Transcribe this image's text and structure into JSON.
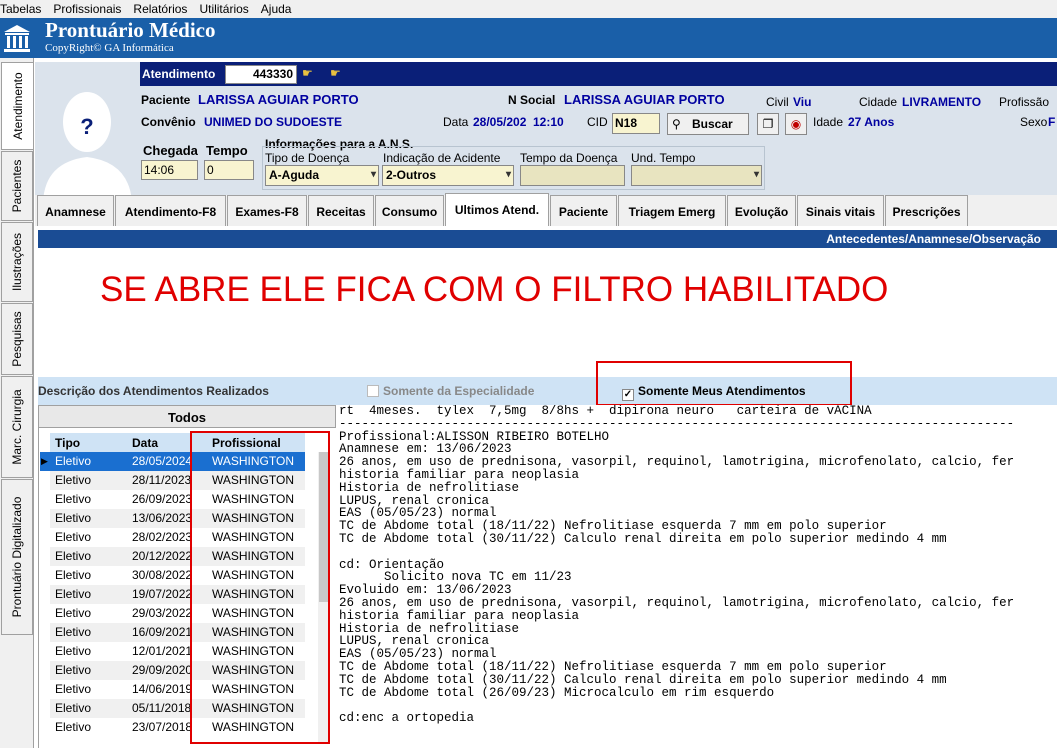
{
  "menu": [
    "Tabelas",
    "Profissionais",
    "Relatórios",
    "Utilitários",
    "Ajuda"
  ],
  "app": {
    "title": "Prontuário Médico",
    "copyright": "CopyRight© GA Informática"
  },
  "side_tabs": [
    "Atendimento",
    "Pacientes",
    "Ilustrações",
    "Pesquisas",
    "Marc. Cirurgia",
    "Prontuário Digitalizado"
  ],
  "header": {
    "atendimento_label": "Atendimento",
    "atendimento_value": "443330",
    "paciente_label": "Paciente",
    "paciente_value": "LARISSA AGUIAR PORTO",
    "nsocial_label": "N Social",
    "nsocial_value": "LARISSA AGUIAR PORTO",
    "civil_label": "Civil",
    "civil_value": "Viu",
    "cidade_label": "Cidade",
    "cidade_value": "LIVRAMENTO",
    "profissao_label": "Profissão",
    "convenio_label": "Convênio",
    "convenio_value": "UNIMED DO SUDOESTE",
    "data_label": "Data",
    "data_value": "28/05/202",
    "hora_value": "12:10",
    "cid_label": "CID",
    "cid_value": "N18",
    "buscar_label": "Buscar",
    "idade_label": "Idade",
    "idade_value": "27 Anos",
    "sexo_label": "Sexo",
    "sexo_value": "F",
    "chegada_label": "Chegada",
    "chegada_value": "14:06",
    "tempo_label": "Tempo",
    "tempo_value": "0",
    "ans_label": "Informações para a A.N.S.",
    "tipo_doenca_label": "Tipo de Doença",
    "tipo_doenca_value": "A-Aguda",
    "indicacao_label": "Indicação de Acidente",
    "indicacao_value": "2-Outros",
    "tempo_doenca_label": "Tempo da Doença",
    "und_tempo_label": "Und. Tempo"
  },
  "tabs": [
    "Anamnese",
    "Atendimento-F8",
    "Exames-F8",
    "Receitas",
    "Consumo",
    "Ultimos Atend.",
    "Paciente",
    "Triagem Emerg",
    "Evolução",
    "Sinais vitais",
    "Prescrições"
  ],
  "active_tab": "Ultimos Atend.",
  "section_title": "Antecedentes/Anamnese/Observação",
  "annotation": "SE ABRE ELE FICA COM O FILTRO HABILITADO",
  "filters": {
    "desc_label": "Descrição dos Atendimentos Realizados",
    "especialidade_label": "Somente da Especialidade",
    "especialidade_checked": false,
    "meus_label": "Somente Meus Atendimentos",
    "meus_checked": true
  },
  "grid": {
    "title": "Todos",
    "columns": [
      "Tipo",
      "Data",
      "Profissional"
    ],
    "rows": [
      [
        "Eletivo",
        "28/05/2024",
        "WASHINGTON"
      ],
      [
        "Eletivo",
        "28/11/2023",
        "WASHINGTON"
      ],
      [
        "Eletivo",
        "26/09/2023",
        "WASHINGTON"
      ],
      [
        "Eletivo",
        "13/06/2023",
        "WASHINGTON"
      ],
      [
        "Eletivo",
        "28/02/2023",
        "WASHINGTON"
      ],
      [
        "Eletivo",
        "20/12/2022",
        "WASHINGTON"
      ],
      [
        "Eletivo",
        "30/08/2022",
        "WASHINGTON"
      ],
      [
        "Eletivo",
        "19/07/2022",
        "WASHINGTON"
      ],
      [
        "Eletivo",
        "29/03/2022",
        "WASHINGTON"
      ],
      [
        "Eletivo",
        "16/09/2021",
        "WASHINGTON"
      ],
      [
        "Eletivo",
        "12/01/2021",
        "WASHINGTON"
      ],
      [
        "Eletivo",
        "29/09/2020",
        "WASHINGTON"
      ],
      [
        "Eletivo",
        "14/06/2019",
        "WASHINGTON"
      ],
      [
        "Eletivo",
        "05/11/2018",
        "WASHINGTON"
      ],
      [
        "Eletivo",
        "23/07/2018",
        "WASHINGTON"
      ]
    ]
  },
  "notes_lines": [
    "rt  4meses.  tylex  7,5mg  8/8hs +  dipirona neuro   carteira de vACINA",
    "------------------------------------------------------------------------------------------",
    "Profissional:ALISSON RIBEIRO BOTELHO",
    "Anamnese em: 13/06/2023",
    "26 anos, em uso de prednisona, vasorpil, requinol, lamotrigina, microfenolato, calcio, fer",
    "historia familiar para neoplasia",
    "Historia de nefrolitiase",
    "LUPUS, renal cronica",
    "EAS (05/05/23) normal",
    "TC de Abdome total (18/11/22) Nefrolitiase esquerda 7 mm em polo superior",
    "TC de Abdome total (30/11/22) Calculo renal direita em polo superior medindo 4 mm",
    "",
    "cd: Orientação",
    "      Solicito nova TC em 11/23",
    "Evoluido em: 13/06/2023",
    "26 anos, em uso de prednisona, vasorpil, requinol, lamotrigina, microfenolato, calcio, fer",
    "historia familiar para neoplasia",
    "Historia de nefrolitiase",
    "LUPUS, renal cronica",
    "EAS (05/05/23) normal",
    "TC de Abdome total (18/11/22) Nefrolitiase esquerda 7 mm em polo superior",
    "TC de Abdome total (30/11/22) Calculo renal direita em polo superior medindo 4 mm",
    "TC de Abdome total (26/09/23) Microcalculo em rim esquerdo",
    "",
    "cd:enc a ortopedia"
  ]
}
